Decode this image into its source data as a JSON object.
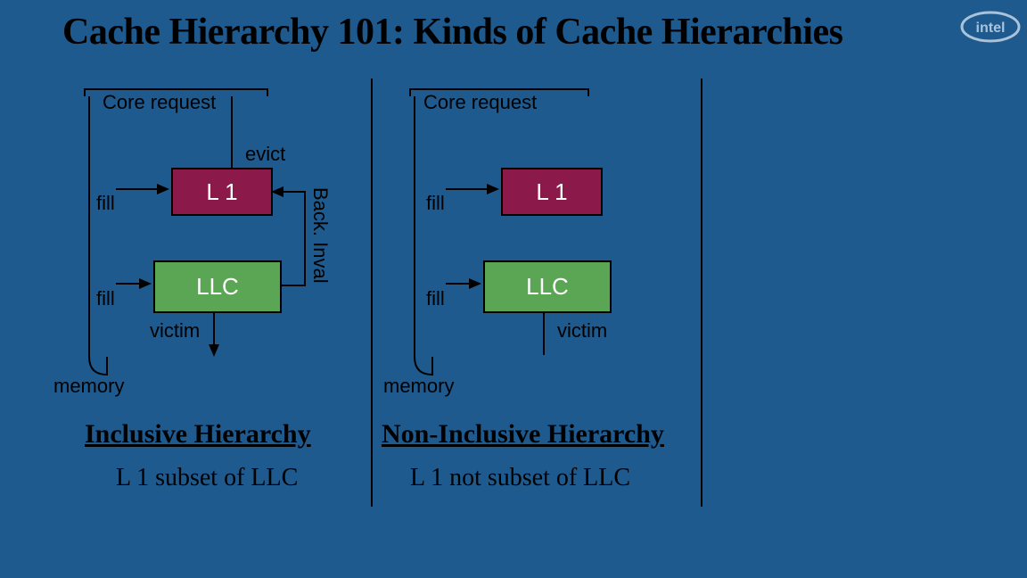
{
  "title": "Cache Hierarchy 101:  Kinds of Cache Hierarchies",
  "logo_name": "intel-logo",
  "left": {
    "core_request": "Core request",
    "evict": "evict",
    "l1": "L 1",
    "fill_top": "fill",
    "llc": "LLC",
    "back_inval": "Back. Inval",
    "fill_bottom": "fill",
    "victim": "victim",
    "memory": "memory",
    "heading": "Inclusive Hierarchy",
    "sub": "L 1 subset of LLC"
  },
  "right": {
    "core_request": "Core request",
    "l1": "L 1",
    "fill_top": "fill",
    "llc": "LLC",
    "fill_bottom": "fill",
    "victim": "victim",
    "memory": "memory",
    "heading": "Non-Inclusive Hierarchy",
    "sub": "L 1 not subset of LLC"
  },
  "colors": {
    "bg": "#1e5a8e",
    "l1": "#8b1a4a",
    "llc": "#5aa654",
    "line": "#000000"
  }
}
